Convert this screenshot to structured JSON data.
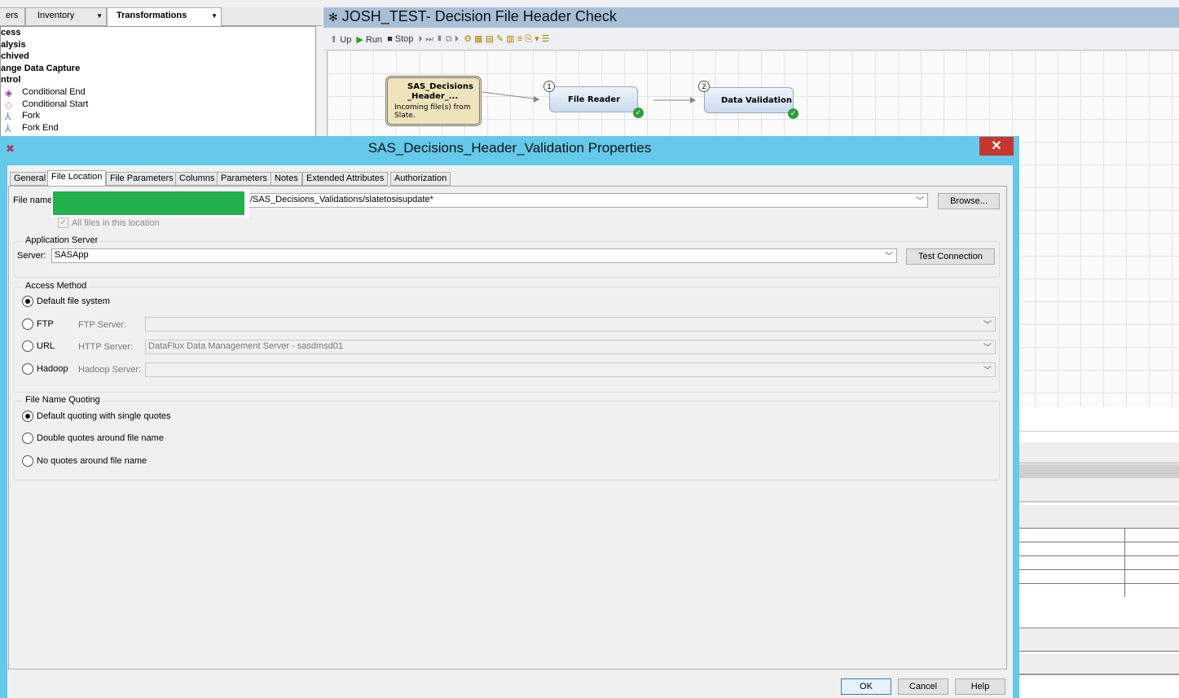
{
  "left_panel": {
    "tabs": [
      {
        "label": "ers"
      },
      {
        "label": "Inventory"
      },
      {
        "label": "Transformations"
      }
    ],
    "tree": {
      "categories": [
        "cess",
        "alysis",
        "chived",
        "ange Data Capture",
        "ntrol"
      ],
      "items": [
        {
          "label": "Conditional End",
          "icon": "diamond-icon"
        },
        {
          "label": "Conditional Start",
          "icon": "diamond-icon"
        },
        {
          "label": "Fork",
          "icon": "fork-icon"
        },
        {
          "label": "Fork End",
          "icon": "fork-end-icon"
        }
      ]
    }
  },
  "job": {
    "title": "JOSH_TEST- Decision File Header Check",
    "toolbar": {
      "up": "Up",
      "run": "Run",
      "stop": "Stop"
    },
    "nodes": {
      "source": {
        "title": "SAS_Decisions _Header_...",
        "desc": "Incoming file(s) from Slate."
      },
      "file_reader": {
        "step": "1",
        "label": "File Reader"
      },
      "data_validation": {
        "step": "2",
        "label": "Data Validation"
      }
    }
  },
  "dialog": {
    "title": "SAS_Decisions_Header_Validation Properties",
    "close": "✕",
    "tabs": [
      "General",
      "File Location",
      "File Parameters",
      "Columns",
      "Parameters",
      "Notes",
      "Extended Attributes",
      "Authorization"
    ],
    "active_tab": "File Location",
    "file_name_label": "File name",
    "file_name_value": "/SAS_Decisions_Validations/slatetosisupdate*",
    "browse": "Browse...",
    "all_files_label": "All files in this location",
    "app_server": {
      "group": "Application Server",
      "label": "Server:",
      "value": "SASApp",
      "test": "Test Connection"
    },
    "access_method": {
      "group": "Access Method",
      "options": [
        {
          "label": "Default file system",
          "selected": true
        },
        {
          "label": "FTP",
          "field_label": "FTP Server:",
          "value": ""
        },
        {
          "label": "URL",
          "field_label": "HTTP Server:",
          "value": "DataFlux Data Management Server - sasdmsd01"
        },
        {
          "label": "Hadoop",
          "field_label": "Hadoop Server:",
          "value": ""
        }
      ]
    },
    "quoting": {
      "group": "File Name Quoting",
      "options": [
        "Default quoting with single quotes",
        "Double quotes around file name",
        "No quotes around file name"
      ]
    },
    "buttons": {
      "ok": "OK",
      "cancel": "Cancel",
      "help": "Help"
    },
    "colors": {
      "title_bar": "#65c9ea",
      "close": "#c7372f",
      "redaction": "#22b14c"
    }
  }
}
